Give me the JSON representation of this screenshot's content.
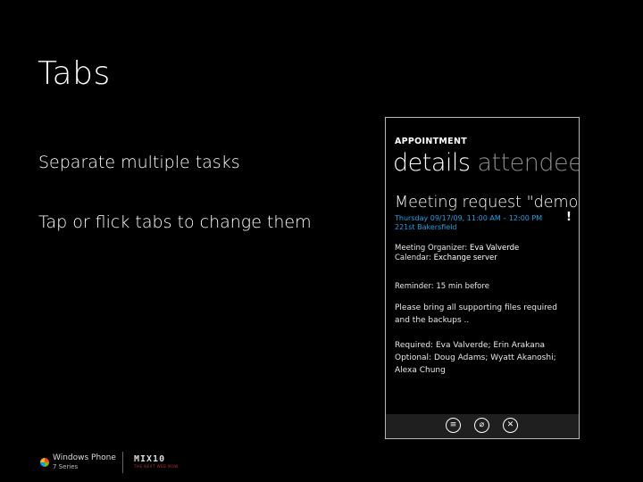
{
  "slide": {
    "title": "Tabs",
    "bullets": [
      "Separate multiple tasks",
      "Tap or flick tabs to change them"
    ]
  },
  "phone": {
    "app_title": "APPOINTMENT",
    "pivot": {
      "active": "details",
      "inactive": "attendee"
    },
    "subject": "Meeting request \"demo",
    "time": "Thursday 09/17/09, 11:00 AM – 12:00 PM",
    "location": "221st Bakersfield",
    "alert": "!",
    "organizer_label": "Meeting Organizer:",
    "organizer_value": "Eva Valverde",
    "calendar_label": "Calendar:",
    "calendar_value": "Exchange server",
    "reminder": "Reminder: 15 min before",
    "body": "Please bring all supporting files required and the backups ..",
    "attendees": "Required: Eva Valverde; Erin Arakana Optional: Doug Adams; Wyatt Akanoshi; Alexa Chung",
    "appbar_icons": [
      "respond-icon",
      "attach-icon",
      "close-icon"
    ]
  },
  "footer": {
    "brand": "Windows Phone",
    "series": "7 Series",
    "event": "MIX10",
    "event_tag": "THE NEXT WEB NOW"
  },
  "colors": {
    "accent": "#1ba1e2",
    "background": "#000000"
  }
}
